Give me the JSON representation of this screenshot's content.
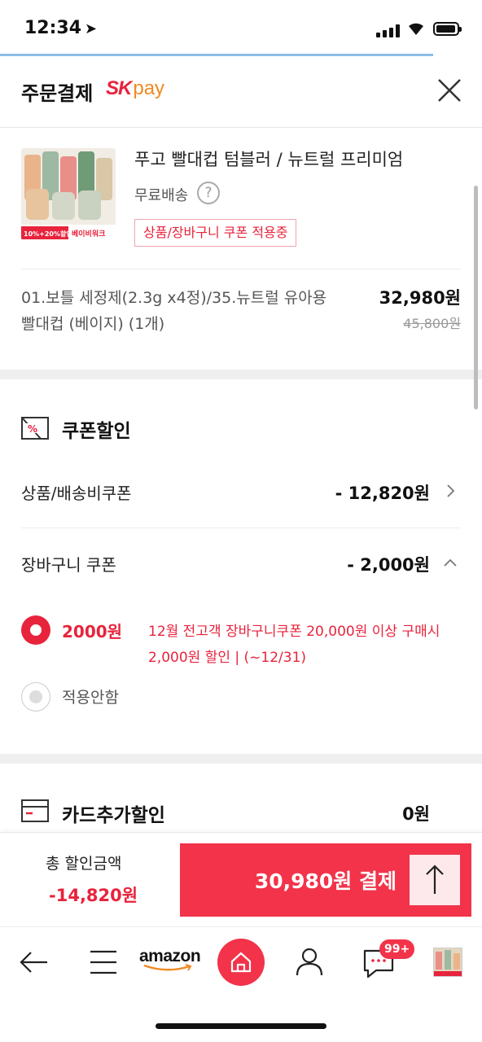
{
  "status_bar": {
    "time": "12:34",
    "location_icon": "location-arrow-icon"
  },
  "header": {
    "title": "주문결제",
    "logo_sk": "SK",
    "logo_pay": "pay",
    "close_icon": "close-icon"
  },
  "product": {
    "name": "푸고 빨대컵 텀블러 / 뉴트럴 프리미엄",
    "shipping": "무료배송",
    "help_icon": "?",
    "coupon_tag": "상품/장바구니 쿠폰 적용중",
    "thumb_badge_left": "10%+20%할인",
    "thumb_badge_right": "베이비워크",
    "option": "01.보틀 세정제(2.3g x4정)/35.뉴트럴 유아용 빨대컵 (베이지) (1개)",
    "price": "32,980원",
    "original_price": "45,800원"
  },
  "coupon_section": {
    "title": "쿠폰할인",
    "rows": [
      {
        "label": "상품/배송비쿠폰",
        "value": "- 12,820원"
      },
      {
        "label": "장바구니 쿠폰",
        "value": "- 2,000원"
      }
    ],
    "options": [
      {
        "label": "2000원",
        "desc": "12월 전고객 장바구니쿠폰 20,000원 이상 구매시 2,000원 할인 | (~12/31)",
        "selected": true
      },
      {
        "label": "적용안함",
        "selected": false
      }
    ]
  },
  "card_section": {
    "title": "카드추가할인",
    "value": "0원"
  },
  "pay_bar": {
    "total_label": "총 할인금액",
    "total_amount": "-14,820원",
    "pay_label": "30,980원 결제"
  },
  "bottom_nav": {
    "amazon": "amazon",
    "chat_badge": "99+"
  },
  "colors": {
    "accent": "#f2334a",
    "sk_red": "#e8233c",
    "pay_orange": "#f08a24"
  }
}
